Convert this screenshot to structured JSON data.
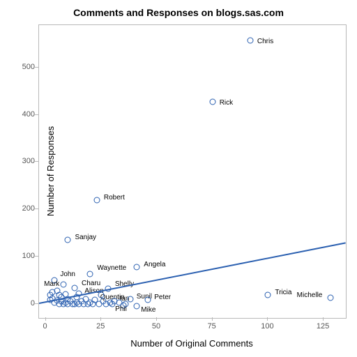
{
  "chart_data": {
    "type": "scatter",
    "title": "Comments and Responses on blogs.sas.com",
    "xlabel": "Number of Original Comments",
    "ylabel": "Number of Responses",
    "xlim": [
      -3,
      135
    ],
    "ylim": [
      -30,
      590
    ],
    "xticks": [
      0,
      25,
      50,
      75,
      100,
      125
    ],
    "yticks": [
      0,
      100,
      200,
      300,
      400,
      500
    ],
    "regression": {
      "x1": -3,
      "y1": 2,
      "x2": 135,
      "y2": 130
    },
    "points": [
      {
        "x": 92,
        "y": 558,
        "label": "Chris",
        "dx": 10,
        "dy": 2
      },
      {
        "x": 75,
        "y": 428,
        "label": "Rick",
        "dx": 10,
        "dy": 2
      },
      {
        "x": 23,
        "y": 220,
        "label": "Robert",
        "dx": 10,
        "dy": -3
      },
      {
        "x": 10,
        "y": 135,
        "label": "Sanjay",
        "dx": 10,
        "dy": -3
      },
      {
        "x": 41,
        "y": 78,
        "label": "Angela",
        "dx": 10,
        "dy": -3
      },
      {
        "x": 20,
        "y": 63,
        "label": "Waynette",
        "dx": 10,
        "dy": -8
      },
      {
        "x": 4,
        "y": 50,
        "label": "John",
        "dx": 8,
        "dy": -8
      },
      {
        "x": 8,
        "y": 41,
        "label": "Mark",
        "dx": -28,
        "dy": 0
      },
      {
        "x": 13,
        "y": 33,
        "label": "Charu",
        "dx": 10,
        "dy": -6
      },
      {
        "x": 28,
        "y": 32,
        "label": "Shelly",
        "dx": 10,
        "dy": -6
      },
      {
        "x": 15,
        "y": 22,
        "label": "Alison",
        "dx": 8,
        "dy": -3
      },
      {
        "x": 100,
        "y": 18,
        "label": "Tricia",
        "dx": 10,
        "dy": -3
      },
      {
        "x": 128,
        "y": 13,
        "label": "Michelle",
        "dx": -48,
        "dy": -3
      },
      {
        "x": 22,
        "y": 8,
        "label": "Quentin",
        "dx": 8,
        "dy": -3
      },
      {
        "x": 31,
        "y": 6,
        "label": "Ian",
        "dx": 7,
        "dy": -3
      },
      {
        "x": 38,
        "y": 10,
        "label": "Sunil",
        "dx": 9,
        "dy": -3
      },
      {
        "x": 46,
        "y": 9,
        "label": "Peter",
        "dx": 9,
        "dy": -3
      },
      {
        "x": 35,
        "y": -3,
        "label": "Phil",
        "dx": -12,
        "dy": 6
      },
      {
        "x": 41,
        "y": -5,
        "label": "Mike",
        "dx": 6,
        "dy": 6
      },
      {
        "x": 2,
        "y": 18
      },
      {
        "x": 2,
        "y": 8
      },
      {
        "x": 3,
        "y": 25
      },
      {
        "x": 3,
        "y": 12
      },
      {
        "x": 4,
        "y": 3
      },
      {
        "x": 5,
        "y": 28
      },
      {
        "x": 5,
        "y": 7
      },
      {
        "x": 6,
        "y": 18
      },
      {
        "x": 6,
        "y": 0
      },
      {
        "x": 7,
        "y": 15
      },
      {
        "x": 7,
        "y": 5
      },
      {
        "x": 8,
        "y": 0
      },
      {
        "x": 9,
        "y": 20
      },
      {
        "x": 9,
        "y": 2
      },
      {
        "x": 10,
        "y": 10
      },
      {
        "x": 10,
        "y": 0
      },
      {
        "x": 11,
        "y": 6
      },
      {
        "x": 12,
        "y": 0
      },
      {
        "x": 13,
        "y": 0
      },
      {
        "x": 14,
        "y": 15
      },
      {
        "x": 14,
        "y": 2
      },
      {
        "x": 15,
        "y": 0
      },
      {
        "x": 16,
        "y": 5
      },
      {
        "x": 17,
        "y": 0
      },
      {
        "x": 18,
        "y": 10
      },
      {
        "x": 19,
        "y": 0
      },
      {
        "x": 20,
        "y": 2
      },
      {
        "x": 21,
        "y": 0
      },
      {
        "x": 24,
        "y": 0
      },
      {
        "x": 25,
        "y": 18
      },
      {
        "x": 26,
        "y": 5
      },
      {
        "x": 27,
        "y": 0
      },
      {
        "x": 29,
        "y": 2
      },
      {
        "x": 30,
        "y": 0
      },
      {
        "x": 33,
        "y": 3
      },
      {
        "x": 36,
        "y": 0
      }
    ]
  }
}
